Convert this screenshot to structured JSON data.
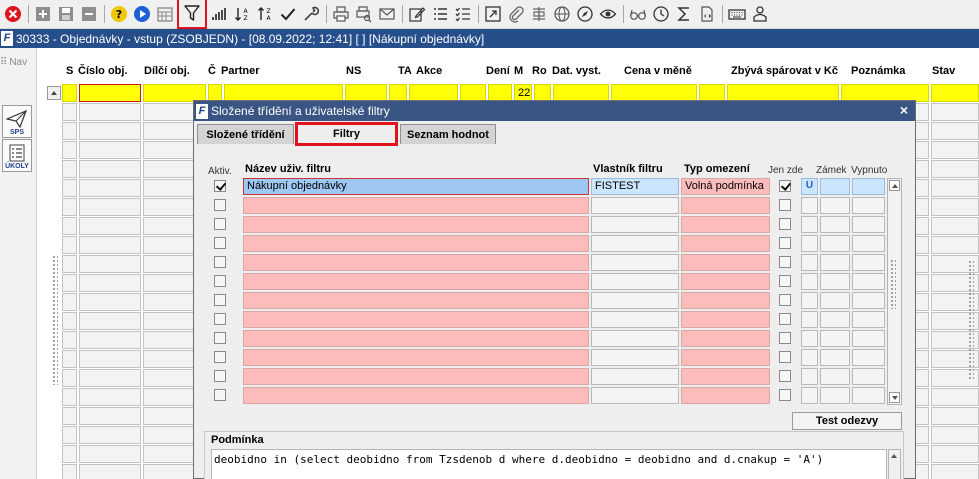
{
  "toolbar": {
    "icons": [
      "close-red-icon",
      "add-record-icon",
      "save-icon",
      "delete-record-icon",
      "help-icon",
      "run-icon",
      "calendar-icon",
      "filter-icon",
      "signal-bars-icon",
      "sort-ascending-icon",
      "sort-descending-icon",
      "check-icon",
      "wrench-icon",
      "print-icon",
      "print-preview-icon",
      "email-icon",
      "edit-icon",
      "list-icon",
      "checklist-icon",
      "open-external-icon",
      "attachment-icon",
      "document-icon",
      "globe-icon",
      "compass-icon",
      "eye-icon",
      "glasses-icon",
      "clock-icon",
      "sum-icon",
      "file-icon",
      "keyboard-icon",
      "person-icon"
    ]
  },
  "window": {
    "title": "30333 - Objednávky - vstup (ZSOBJEDN) - [08.09.2022; 12:41]  [ ]  [Nákupní objednávky]"
  },
  "left": {
    "nav_label": "Nav",
    "sps_label": "SPS",
    "ukoly_label": "ÚKOLY"
  },
  "grid": {
    "headers": [
      "S",
      "Číslo obj.",
      "Dílčí obj.",
      "Č",
      "Partner",
      "NS",
      "TA",
      "Akce",
      "Dení",
      "M",
      "Ro",
      "Dat. vyst.",
      "Cena v měně",
      "Zbývá spárovat v Kč",
      "Poznámka",
      "Stav"
    ],
    "first_row_ro": "22"
  },
  "modal": {
    "title": "Složené třídění a uživatelské filtry",
    "close": "×",
    "tabs": [
      "Složené třídění",
      "Filtry",
      "Seznam hodnot"
    ],
    "active_tab": "Filtry",
    "columns": {
      "aktiv": "Aktiv.",
      "nazev": "Název uživ. filtru",
      "vlastnik": "Vlastník filtru",
      "typ": "Typ omezení",
      "jen_zde": "Jen zde",
      "zamek": "Zámek",
      "vypnuto": "Vypnuto"
    },
    "rows": [
      {
        "aktiv": true,
        "nazev": "Nákupní objednávky",
        "vlastnik": "FISTEST",
        "typ": "Volná podmínka",
        "jen_zde": true,
        "zamek": "U"
      }
    ],
    "test_button": "Test odezvy",
    "podminka_label": "Podmínka",
    "podminka_text": "deobidno in (select deobidno from Tzsdenob d where d.deobidno = deobidno and d.cnakup = 'A')"
  },
  "colors": {
    "titlebar": "#254e8a",
    "modal_titlebar": "#3a5583",
    "highlight_red": "#e0121b",
    "grid_yellow": "#ffff05",
    "row_pink": "#fcbcbc",
    "row_blue": "#cce5ff"
  }
}
